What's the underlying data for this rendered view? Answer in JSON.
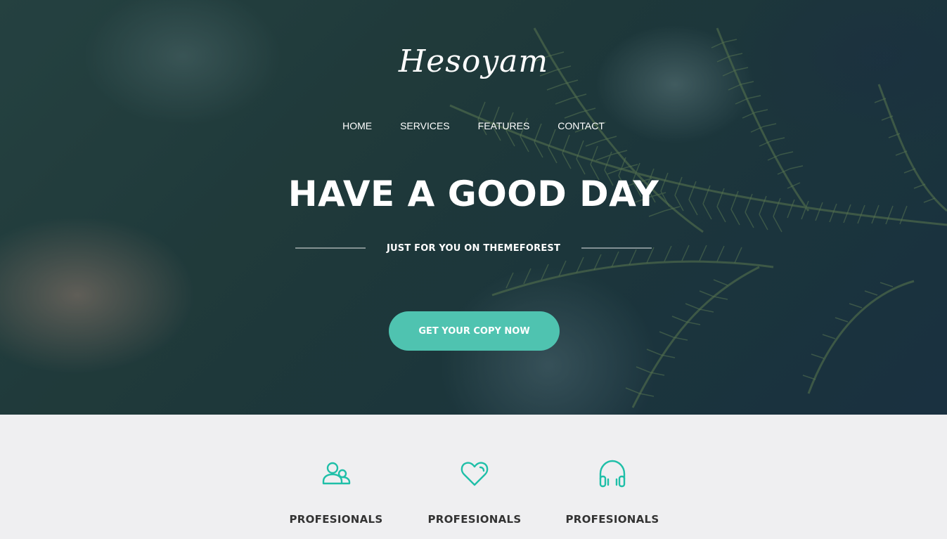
{
  "brand": {
    "logo_text": "Hesoyam"
  },
  "nav": {
    "items": [
      {
        "label": "HOME"
      },
      {
        "label": "SERVICES"
      },
      {
        "label": "FEATURES"
      },
      {
        "label": "CONTACT"
      }
    ]
  },
  "hero": {
    "headline": "HAVE A GOOD DAY",
    "tagline": "JUST FOR YOU ON THEMEFOREST",
    "cta_label": "GET YOUR COPY NOW"
  },
  "features": {
    "items": [
      {
        "icon": "users-icon",
        "label": "PROFESIONALS"
      },
      {
        "icon": "heart-icon",
        "label": "PROFESIONALS"
      },
      {
        "icon": "headphones-icon",
        "label": "PROFESIONALS"
      }
    ]
  },
  "colors": {
    "accent": "#4fc3b0",
    "features_bg": "#efeff1",
    "feature_text": "#333333"
  }
}
